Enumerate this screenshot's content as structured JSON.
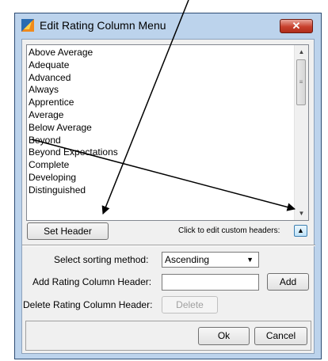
{
  "window": {
    "title": "Edit Rating Column Menu",
    "close_glyph": "✕"
  },
  "list": {
    "items": [
      "Above Average",
      "Adequate",
      "Advanced",
      "Always",
      "Apprentice",
      "Average",
      "Below Average",
      "Beyond",
      "Beyond Expectations",
      "Complete",
      "Developing",
      "Distinguished"
    ]
  },
  "buttons": {
    "set_header": "Set Header",
    "add": "Add",
    "delete": "Delete",
    "ok": "Ok",
    "cancel": "Cancel"
  },
  "hint": {
    "text": "Click to edit custom headers:",
    "toggle_glyph": "▲"
  },
  "sorting": {
    "label": "Select sorting method:",
    "value": "Ascending"
  },
  "add_header": {
    "label": "Add Rating Column Header:",
    "value": ""
  },
  "delete_header": {
    "label": "Delete Rating Column Header:"
  },
  "icons": {
    "app": "app-icon",
    "scroll_up": "chevron-up-icon",
    "scroll_down": "chevron-down-icon",
    "grip": "grip-icon"
  },
  "colors": {
    "window_frame": "#bcd3ec",
    "close_button": "#c8402d",
    "annotation": "#000000"
  }
}
